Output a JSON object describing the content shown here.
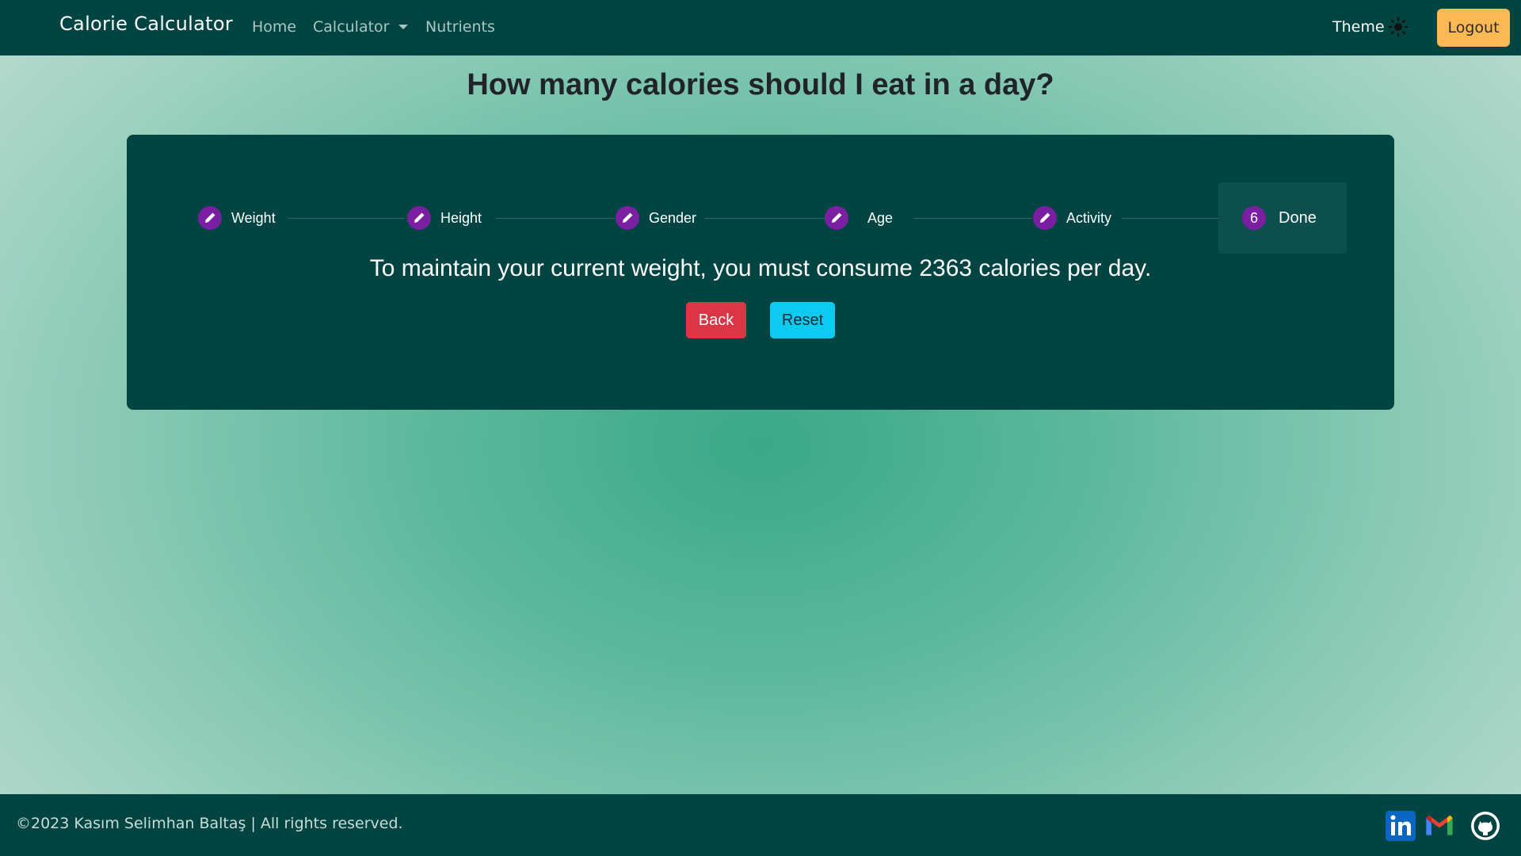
{
  "navbar": {
    "brand": "Calorie Calculator",
    "links": [
      {
        "label": "Home"
      },
      {
        "label": "Calculator"
      },
      {
        "label": "Nutrients"
      }
    ],
    "theme_label": "Theme",
    "logout_label": "Logout"
  },
  "page_title": "How many calories should I eat in a day?",
  "stepper": {
    "steps": [
      {
        "label": "Weight",
        "icon": "pencil-icon"
      },
      {
        "label": "Height",
        "icon": "pencil-icon"
      },
      {
        "label": "Gender",
        "icon": "pencil-icon"
      },
      {
        "label": "Age",
        "icon": "pencil-icon"
      },
      {
        "label": "Activity",
        "icon": "pencil-icon"
      },
      {
        "label": "Done",
        "number": "6"
      }
    ]
  },
  "result_text": "To maintain your current weight, you must consume 2363 calories per day.",
  "buttons": {
    "back": "Back",
    "reset": "Reset"
  },
  "footer": {
    "copyright": "©2023 Kasım Selimhan Baltaş | All rights reserved.",
    "social": [
      "linkedin-icon",
      "gmail-icon",
      "github-icon"
    ]
  },
  "colors": {
    "nav_bg": "#014442",
    "accent_purple": "#7a1fa2",
    "back_button": "#dc3545",
    "reset_button": "#0dcaf0",
    "logout_button": "#fbb955"
  }
}
